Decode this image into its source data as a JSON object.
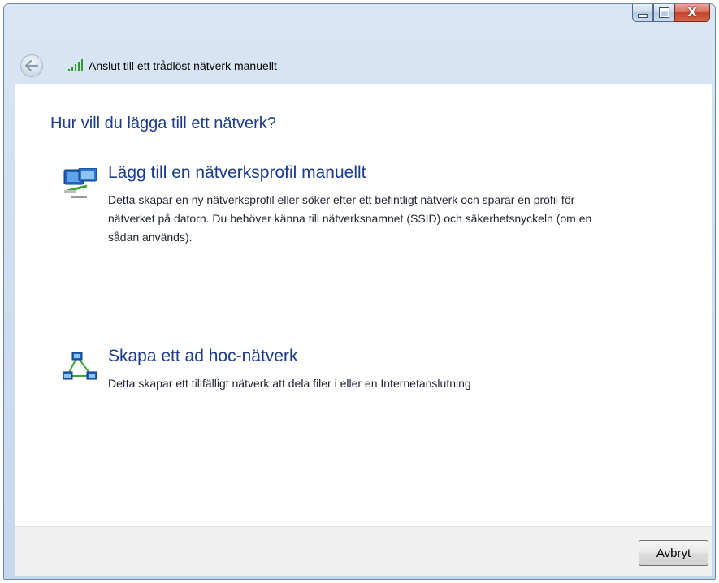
{
  "window": {
    "caption_buttons": [
      "minimize",
      "maximize",
      "close"
    ],
    "close_glyph": "X"
  },
  "navbar": {
    "back_icon": "back-arrow-icon",
    "title_icon": "wireless-signal-icon",
    "title": "Anslut till ett trådlöst nätverk manuellt"
  },
  "main": {
    "heading": "Hur vill du lägga till ett nätverk?",
    "options": [
      {
        "icon": "network-profile-icon",
        "title": "Lägg till en nätverksprofil manuellt",
        "description": "Detta skapar en ny nätverksprofil eller söker efter ett befintligt nätverk och sparar en profil för nätverket på datorn. Du behöver känna till nätverksnamnet (SSID) och säkerhetsnyckeln (om en sådan används)."
      },
      {
        "icon": "ad-hoc-network-icon",
        "title": "Skapa ett ad hoc-nätverk",
        "description": "Detta skapar ett tillfälligt nätverk att dela filer i eller en Internetanslutning"
      }
    ]
  },
  "footer": {
    "cancel_label": "Avbryt"
  },
  "colors": {
    "heading": "#1e3c8c",
    "link_title": "#1a3a8c",
    "close_button": "#c4432a",
    "signal": "#2e9b2e"
  }
}
